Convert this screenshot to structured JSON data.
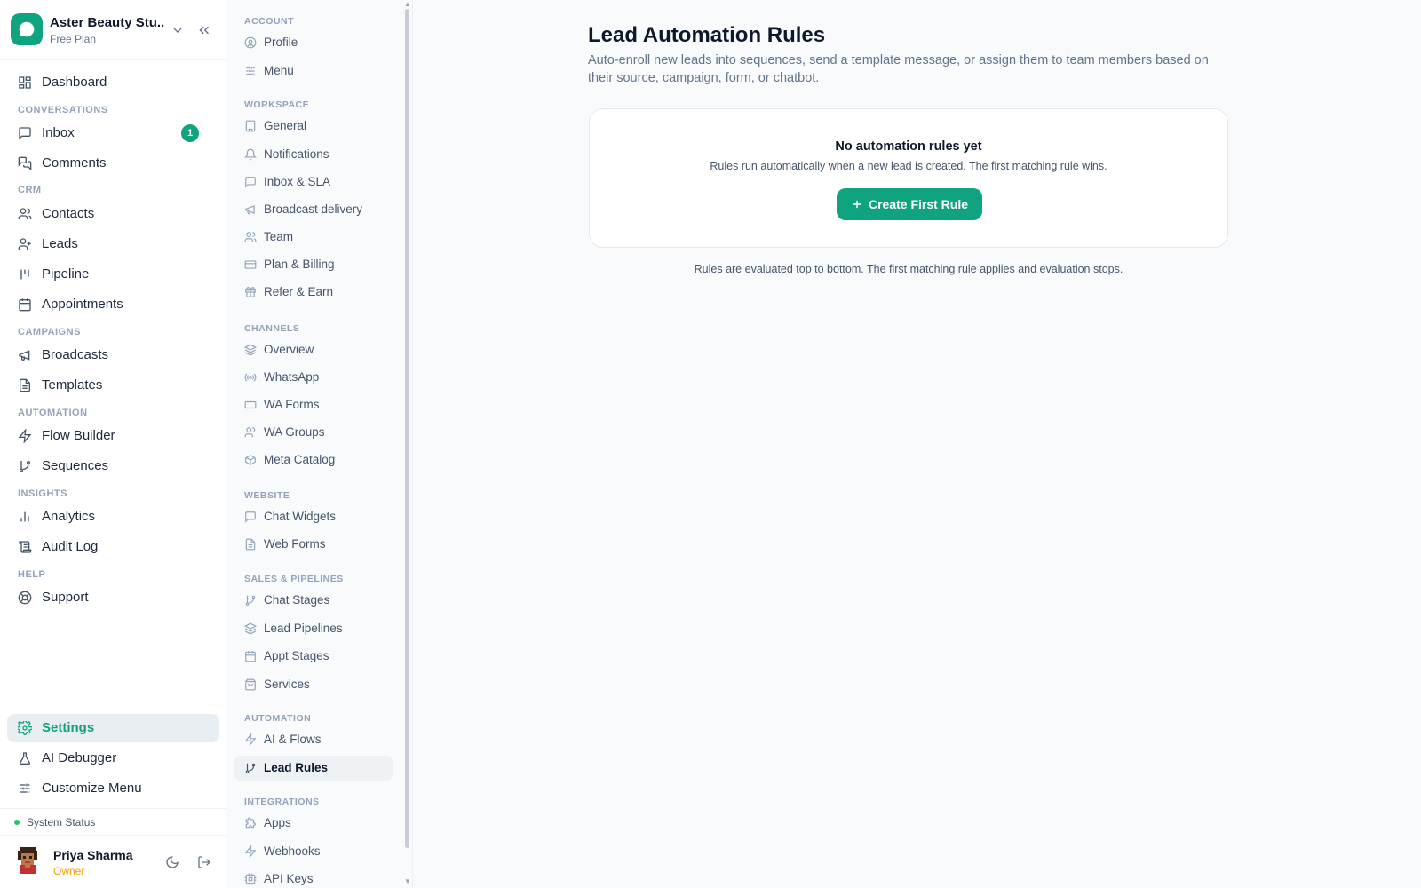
{
  "workspace": {
    "name": "Aster Beauty Stu...",
    "plan": "Free Plan"
  },
  "sidebar": {
    "sections": {
      "conversations": "CONVERSATIONS",
      "crm": "CRM",
      "campaigns": "CAMPAIGNS",
      "automation": "AUTOMATION",
      "insights": "INSIGHTS",
      "help": "HELP"
    },
    "items": {
      "dashboard": "Dashboard",
      "inbox": "Inbox",
      "inbox_badge": "1",
      "comments": "Comments",
      "contacts": "Contacts",
      "leads": "Leads",
      "pipeline": "Pipeline",
      "appointments": "Appointments",
      "broadcasts": "Broadcasts",
      "templates": "Templates",
      "flow_builder": "Flow Builder",
      "sequences": "Sequences",
      "analytics": "Analytics",
      "audit_log": "Audit Log",
      "support": "Support",
      "settings": "Settings",
      "ai_debugger": "AI Debugger",
      "customize_menu": "Customize Menu"
    },
    "system_status": "System Status",
    "user": {
      "name": "Priya Sharma",
      "role": "Owner"
    }
  },
  "settings_nav": {
    "sections": {
      "account": "ACCOUNT",
      "workspace": "WORKSPACE",
      "channels": "CHANNELS",
      "website": "WEBSITE",
      "sales": "SALES & PIPELINES",
      "automation": "AUTOMATION",
      "integrations": "INTEGRATIONS"
    },
    "items": {
      "profile": "Profile",
      "menu": "Menu",
      "general": "General",
      "notifications": "Notifications",
      "inbox_sla": "Inbox & SLA",
      "broadcast_delivery": "Broadcast delivery",
      "team": "Team",
      "plan_billing": "Plan & Billing",
      "refer_earn": "Refer & Earn",
      "overview": "Overview",
      "whatsapp": "WhatsApp",
      "wa_forms": "WA Forms",
      "wa_groups": "WA Groups",
      "meta_catalog": "Meta Catalog",
      "chat_widgets": "Chat Widgets",
      "web_forms": "Web Forms",
      "chat_stages": "Chat Stages",
      "lead_pipelines": "Lead Pipelines",
      "appt_stages": "Appt Stages",
      "services": "Services",
      "ai_flows": "AI & Flows",
      "lead_rules": "Lead Rules",
      "apps": "Apps",
      "webhooks": "Webhooks",
      "api_keys": "API Keys"
    }
  },
  "main": {
    "title": "Lead Automation Rules",
    "description": "Auto-enroll new leads into sequences, send a template message, or assign them to team members based on their source, campaign, form, or chatbot.",
    "empty_title": "No automation rules yet",
    "empty_subtitle": "Rules run automatically when a new lead is created. The first matching rule wins.",
    "create_button": "Create First Rule",
    "footnote": "Rules are evaluated top to bottom. The first matching rule applies and evaluation stops."
  },
  "colors": {
    "accent": "#10a37f",
    "role": "#f59e0b",
    "status": "#22c55e"
  }
}
